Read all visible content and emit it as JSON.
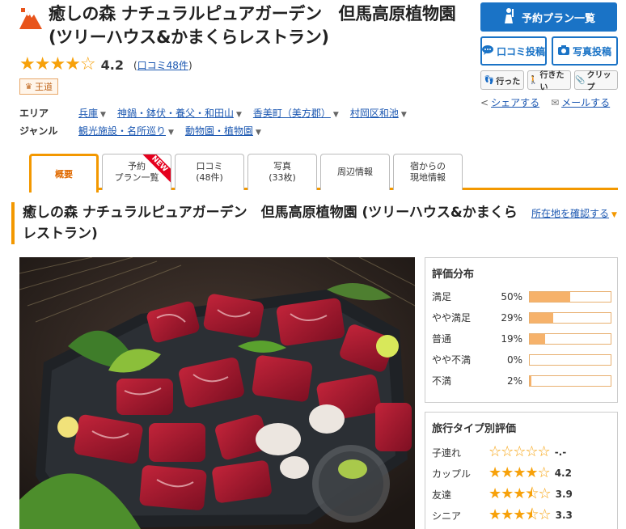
{
  "header": {
    "title": "癒しの森 ナチュラルピュアガーデン　但馬高原植物園 (ツリーハウス&かまくらレストラン)",
    "rating": "4.2",
    "review_link": "口コミ48件",
    "badge": "王道"
  },
  "meta": {
    "area_label": "エリア",
    "area": [
      "兵庫",
      "神鍋・鉢伏・養父・和田山",
      "香美町（美方郡）",
      "村岡区和池"
    ],
    "genre_label": "ジャンル",
    "genre": [
      "観光施設・名所巡り",
      "動物園・植物園"
    ]
  },
  "actions": {
    "plan": "予約プラン一覧",
    "review_post": "口コミ投稿",
    "photo_post": "写真投稿",
    "went": "行った",
    "want": "行きたい",
    "clip": "クリップ",
    "share": "シェアする",
    "mail": "メールする"
  },
  "tabs": [
    {
      "line1": "概要",
      "line2": ""
    },
    {
      "line1": "予約",
      "line2": "プラン一覧"
    },
    {
      "line1": "口コミ",
      "line2": "(48件)"
    },
    {
      "line1": "写真",
      "line2": "(33枚)"
    },
    {
      "line1": "周辺情報",
      "line2": ""
    },
    {
      "line1": "宿からの",
      "line2": "現地情報"
    }
  ],
  "new_ribbon": "NEW",
  "section": {
    "title": "癒しの森 ナチュラルピュアガーデン　但馬高原植物園 (ツリーハウス&かまくらレストラン)",
    "location_link": "所在地を確認する"
  },
  "distribution": {
    "title": "評価分布",
    "rows": [
      {
        "label": "満足",
        "pct": "50%",
        "value": 50
      },
      {
        "label": "やや満足",
        "pct": "29%",
        "value": 29
      },
      {
        "label": "普通",
        "pct": "19%",
        "value": 19
      },
      {
        "label": "やや不満",
        "pct": "0%",
        "value": 0
      },
      {
        "label": "不満",
        "pct": "2%",
        "value": 2
      }
    ]
  },
  "travel_type": {
    "title": "旅行タイプ別評価",
    "rows": [
      {
        "label": "子連れ",
        "score": "-.-",
        "rating": 0
      },
      {
        "label": "カップル",
        "score": "4.2",
        "rating": 4.2
      },
      {
        "label": "友達",
        "score": "3.9",
        "rating": 3.9
      },
      {
        "label": "シニア",
        "score": "3.3",
        "rating": 3.3
      }
    ]
  },
  "colors": {
    "accent_orange": "#f39800",
    "star": "#f7a10a",
    "link_blue": "#1b57b1",
    "button_blue": "#1a73c6",
    "bar_fill": "#f6b26b"
  }
}
